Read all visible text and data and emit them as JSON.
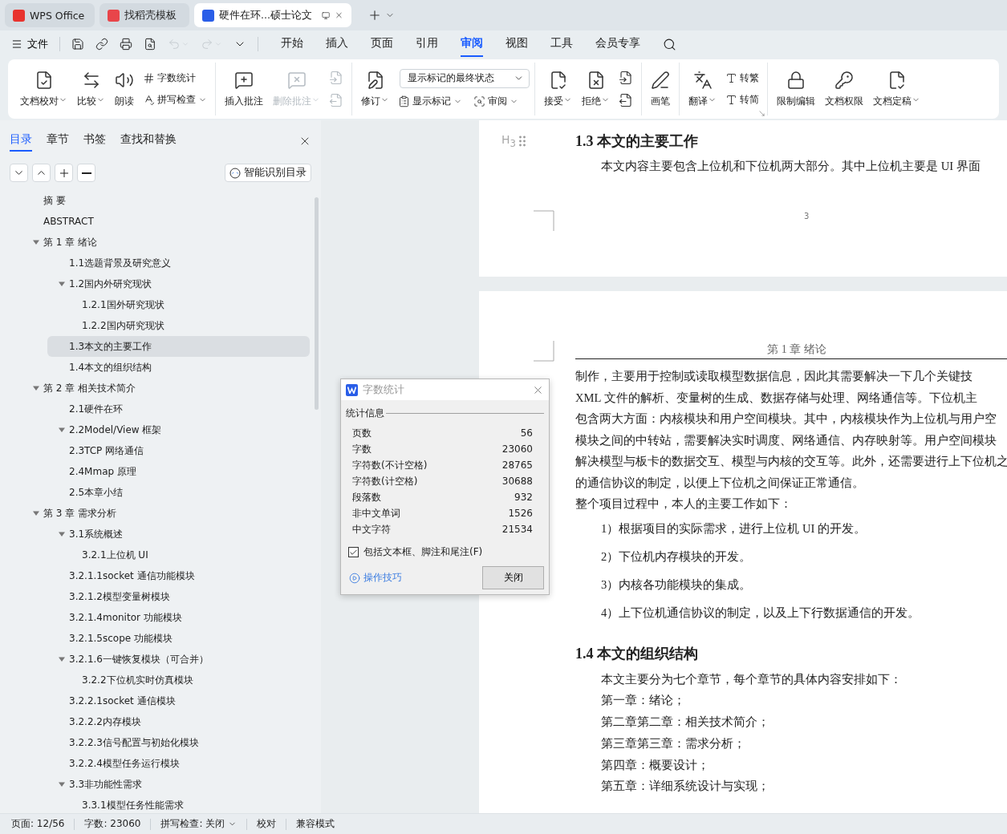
{
  "app_tabs": [
    {
      "label": "WPS Office",
      "selected": false
    },
    {
      "label": "找稻壳模板",
      "selected": false
    },
    {
      "label": "硬件在环...硕士论文",
      "selected": true
    }
  ],
  "file_menu": {
    "label": "文件"
  },
  "quick_access": [
    {
      "disabled": false,
      "dropdown": false
    },
    {
      "disabled": false,
      "dropdown": false
    },
    {
      "disabled": false,
      "dropdown": false
    },
    {
      "disabled": false,
      "dropdown": false
    },
    {
      "disabled": true,
      "dropdown": true
    },
    {
      "disabled": true,
      "dropdown": true
    }
  ],
  "menu_tabs": [
    {
      "label": "开始",
      "selected": false
    },
    {
      "label": "插入",
      "selected": false
    },
    {
      "label": "页面",
      "selected": false
    },
    {
      "label": "引用",
      "selected": false
    },
    {
      "label": "审阅",
      "selected": true
    },
    {
      "label": "视图",
      "selected": false
    },
    {
      "label": "工具",
      "selected": false
    },
    {
      "label": "会员专享",
      "selected": false
    }
  ],
  "ribbon": {
    "groups": [
      {
        "columns": [
          [
            {
              "kind": "large",
              "label": "文档校对",
              "dropdown": true,
              "disabled": false
            }
          ],
          [
            {
              "kind": "large",
              "label": "比较",
              "dropdown": true,
              "disabled": false
            }
          ],
          [
            {
              "kind": "large",
              "label": "朗读",
              "dropdown": false,
              "disabled": false
            }
          ],
          [
            {
              "kind": "small",
              "label": "字数统计",
              "dropdown": false,
              "disabled": false
            },
            {
              "kind": "small",
              "label": "拼写检查",
              "dropdown": true,
              "disabled": false
            }
          ]
        ]
      },
      {
        "columns": [
          [
            {
              "kind": "large",
              "label": "插入批注",
              "dropdown": false,
              "disabled": false
            }
          ],
          [
            {
              "kind": "large",
              "label": "删除批注",
              "dropdown": true,
              "disabled": true
            }
          ],
          [
            {
              "kind": "icon",
              "disabled": true
            },
            {
              "kind": "icon",
              "disabled": true
            }
          ]
        ]
      },
      {
        "columns": [
          [
            {
              "kind": "large",
              "label": "修订",
              "dropdown": true,
              "disabled": false
            }
          ],
          [
            {
              "kind": "select",
              "value": "显示标记的最终状态"
            },
            {
              "kind": "small",
              "label": "显示标记",
              "dropdown": true,
              "disabled": false
            },
            {
              "kind": "small",
              "label": "审阅",
              "dropdown": true,
              "disabled": false
            }
          ]
        ]
      },
      {
        "columns": [
          [
            {
              "kind": "large",
              "label": "接受",
              "dropdown": true,
              "disabled": false
            }
          ],
          [
            {
              "kind": "large",
              "label": "拒绝",
              "dropdown": true,
              "disabled": false
            }
          ],
          [
            {
              "kind": "icon",
              "disabled": false
            },
            {
              "kind": "icon",
              "disabled": false
            }
          ]
        ]
      },
      {
        "columns": [
          [
            {
              "kind": "large",
              "label": "画笔",
              "dropdown": false,
              "disabled": false
            }
          ]
        ]
      },
      {
        "columns": [
          [
            {
              "kind": "large",
              "label": "翻译",
              "dropdown": true,
              "disabled": false
            }
          ],
          [
            {
              "kind": "small",
              "label": "转繁",
              "dropdown": false,
              "disabled": false
            },
            {
              "kind": "small",
              "label": "转简",
              "dropdown": false,
              "disabled": false
            }
          ]
        ]
      },
      {
        "columns": [
          [
            {
              "kind": "large",
              "label": "限制编辑",
              "dropdown": false,
              "disabled": false
            }
          ],
          [
            {
              "kind": "large",
              "label": "文档权限",
              "dropdown": false,
              "disabled": false
            }
          ],
          [
            {
              "kind": "large",
              "label": "文档定稿",
              "dropdown": true,
              "disabled": false
            }
          ]
        ]
      }
    ]
  },
  "nav_pane": {
    "tabs": [
      {
        "label": "目录",
        "selected": true
      },
      {
        "label": "章节",
        "selected": false
      },
      {
        "label": "书签",
        "selected": false
      },
      {
        "label": "查找和替换",
        "selected": false
      }
    ],
    "smart_button": "智能识别目录",
    "toc": [
      {
        "label": "摘 要",
        "selected": false
      },
      {
        "label": "ABSTRACT",
        "selected": false
      },
      {
        "label": "第 1 章 绪论",
        "selected": false,
        "expanded": true,
        "children": [
          {
            "label": "1.1选题背景及研究意义",
            "selected": false
          },
          {
            "label": "1.2国内外研究现状",
            "selected": false,
            "expanded": true,
            "children": [
              {
                "label": "1.2.1国外研究现状",
                "selected": false
              },
              {
                "label": "1.2.2国内研究现状",
                "selected": false
              }
            ]
          },
          {
            "label": "1.3本文的主要工作",
            "selected": true
          },
          {
            "label": "1.4本文的组织结构",
            "selected": false
          }
        ]
      },
      {
        "label": "第 2 章 相关技术简介",
        "selected": false,
        "expanded": true,
        "children": [
          {
            "label": "2.1硬件在环",
            "selected": false
          },
          {
            "label": "2.2Model/View 框架",
            "selected": false,
            "expanded": true
          },
          {
            "label": "2.3TCP 网络通信",
            "selected": false
          },
          {
            "label": "2.4Mmap 原理",
            "selected": false
          },
          {
            "label": "2.5本章小结",
            "selected": false
          }
        ]
      },
      {
        "label": "第 3 章 需求分析",
        "selected": false,
        "expanded": true,
        "children": [
          {
            "label": "3.1系统概述",
            "selected": false,
            "expanded": true,
            "children": [
              {
                "label": "3.2.1上位机 UI",
                "selected": false
              }
            ]
          },
          {
            "label": "3.2.1.1socket 通信功能模块",
            "selected": false
          },
          {
            "label": "3.2.1.2模型变量树模块",
            "selected": false
          },
          {
            "label": "3.2.1.4monitor 功能模块",
            "selected": false
          },
          {
            "label": "3.2.1.5scope 功能模块",
            "selected": false
          },
          {
            "label": "3.2.1.6一键恢复模块（可合并）",
            "selected": false,
            "expanded": true,
            "children": [
              {
                "label": "3.2.2下位机实时仿真模块",
                "selected": false
              }
            ]
          },
          {
            "label": "3.2.2.1socket 通信模块",
            "selected": false
          },
          {
            "label": "3.2.2.2内存模块",
            "selected": false
          },
          {
            "label": "3.2.2.3信号配置与初始化模块",
            "selected": false
          },
          {
            "label": "3.2.2.4模型任务运行模块",
            "selected": false
          },
          {
            "label": "3.3非功能性需求",
            "selected": false,
            "expanded": true,
            "children": [
              {
                "label": "3.3.1模型任务性能需求",
                "selected": false
              }
            ]
          }
        ]
      }
    ]
  },
  "document": {
    "page_1": {
      "heading_marker": "H$_{3}$",
      "heading": "1.3  本文的主要工作",
      "paragraph": "本文内容主要包含上位机和下位机两大部分。其中上位机主要是 UI 界面",
      "page_number": "3"
    },
    "page_2": {
      "header": "第 1 章  绪论",
      "blocks": [
        {
          "kind": "line",
          "text": "制作，主要用于控制或读取模型数据信息，因此其需要解决一下几个关键技"
        },
        {
          "kind": "line",
          "text": "XML 文件的解析、变量树的生成、数据存储与处理、网络通信等。下位机主"
        },
        {
          "kind": "line",
          "text": "包含两大方面：内核模块和用户空间模块。其中，内核模块作为上位机与用户空"
        },
        {
          "kind": "line",
          "text": "模块之间的中转站，需要解决实时调度、网络通信、内存映射等。用户空间模块"
        },
        {
          "kind": "line",
          "text": "解决模型与板卡的数据交互、模型与内核的交互等。此外，还需要进行上下位机之"
        },
        {
          "kind": "line",
          "text": "的通信协议的制定，以便上下位机之间保证正常通信。"
        },
        {
          "kind": "line",
          "text": "整个项目过程中，本人的主要工作如下："
        },
        {
          "kind": "list",
          "text": "1）根据项目的实际需求，进行上位机  UI 的开发。"
        },
        {
          "kind": "list",
          "text": "2）下位机内存模块的开发。"
        },
        {
          "kind": "list",
          "text": "3）内核各功能模块的集成。"
        },
        {
          "kind": "list",
          "text": "4）上下位机通信协议的制定，以及上下行数据通信的开发。"
        },
        {
          "kind": "heading",
          "text": "1.4  本文的组织结构"
        },
        {
          "kind": "indent",
          "text": "本文主要分为七个章节，每个章节的具体内容安排如下："
        },
        {
          "kind": "indent",
          "text": "第一章：绪论；"
        },
        {
          "kind": "indent",
          "text": "第二章第二章：相关技术简介；"
        },
        {
          "kind": "indent",
          "text": "第三章第三章：需求分析；"
        },
        {
          "kind": "indent",
          "text": "第四章：概要设计；"
        },
        {
          "kind": "indent",
          "text": "第五章：详细系统设计与实现；"
        }
      ]
    }
  },
  "word_count_dialog": {
    "title": "字数统计",
    "section": "统计信息",
    "rows": [
      {
        "label": "页数",
        "value": "56"
      },
      {
        "label": "字数",
        "value": "23060"
      },
      {
        "label": "字符数(不计空格)",
        "value": "28765"
      },
      {
        "label": "字符数(计空格)",
        "value": "30688"
      },
      {
        "label": "段落数",
        "value": "932"
      },
      {
        "label": "非中文单词",
        "value": "1526"
      },
      {
        "label": "中文字符",
        "value": "21534"
      }
    ],
    "include_option": {
      "label": "包括文本框、脚注和尾注(F)",
      "checked": true
    },
    "tips_link": "操作技巧",
    "close_button": "关闭"
  },
  "status_bar": [
    {
      "text": "页面: 12/56",
      "dropdown": false
    },
    {
      "text": "字数: 23060",
      "dropdown": false
    },
    {
      "text": "拼写检查: 关闭",
      "dropdown": true
    },
    {
      "text": "校对",
      "dropdown": false
    },
    {
      "text": "兼容模式",
      "dropdown": false
    }
  ]
}
